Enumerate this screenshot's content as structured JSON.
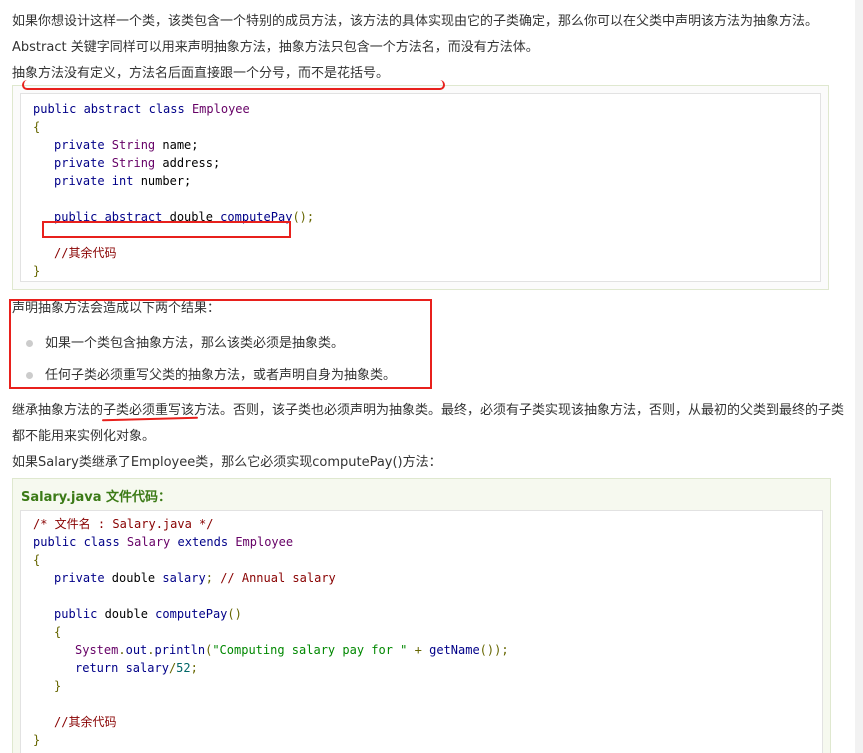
{
  "intro": {
    "line1": "如果你想设计这样一个类，该类包含一个特别的成员方法，该方法的具体实现由它的子类确定，那么你可以在父类中声明该方法为抽象方法。",
    "line2": "Abstract 关键字同样可以用来声明抽象方法，抽象方法只包含一个方法名，而没有方法体。",
    "line3": "抽象方法没有定义，方法名后面直接跟一个分号，而不是花括号。"
  },
  "code1": {
    "l1": [
      "public abstract class ",
      "Employee"
    ],
    "l2": "{",
    "l3": [
      "private ",
      "String",
      " name;"
    ],
    "l4": [
      "private ",
      "String",
      " address;"
    ],
    "l5": [
      "private ",
      "int",
      " number;"
    ],
    "l7": [
      "public abstract ",
      "double",
      " computePay",
      "();"
    ],
    "l9": "//其余代码",
    "l10": "}"
  },
  "consequences": {
    "heading": "声明抽象方法会造成以下两个结果：",
    "items": [
      "如果一个类包含抽象方法，那么该类必须是抽象类。",
      "任何子类必须重写父类的抽象方法，或者声明自身为抽象类。"
    ]
  },
  "inherit": {
    "line1": "继承抽象方法的子类必须重写该方法。否则，该子类也必须声明为抽象类。最终，必须有子类实现该抽象方法，否则，从最初的父类到最终的子类",
    "line2": "都不能用来实例化对象。",
    "line3": "如果Salary类继承了Employee类，那么它必须实现computePay()方法："
  },
  "example": {
    "title": "Salary.java 文件代码：",
    "l1": "/* 文件名 : Salary.java */",
    "l2": [
      "public class ",
      "Salary",
      " extends ",
      "Employee"
    ],
    "l3": "{",
    "l4": [
      "private ",
      "double",
      " salary",
      "; ",
      "// Annual salary"
    ],
    "l6": [
      "public ",
      "double",
      " computePay",
      "()"
    ],
    "l7": "{",
    "l8": [
      "System",
      ".",
      "out",
      ".",
      "println",
      "(",
      "\"Computing salary pay for \"",
      " + ",
      "getName",
      "());"
    ],
    "l9": [
      "return",
      " salary",
      "/",
      "52",
      ";"
    ],
    "l10": "}",
    "l12": "//其余代码",
    "l13": "}"
  },
  "colors": {
    "annotation": "#e8201c",
    "title_green": "#3b7a16"
  }
}
